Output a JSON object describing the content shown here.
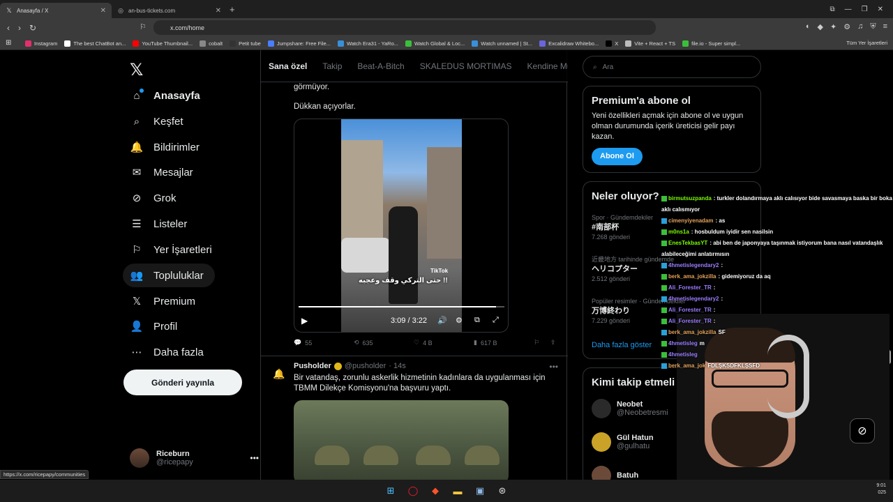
{
  "browser": {
    "tabs": [
      {
        "title": "Anasayfa / X",
        "icon": "x-logo-icon",
        "active": true
      },
      {
        "title": "an-bus-tickets.com",
        "icon": "globe-icon",
        "active": false
      }
    ],
    "url": "x.com/home",
    "bookmarks": [
      {
        "label": "Instagram",
        "color": "#e1306c"
      },
      {
        "label": "The best ChatBot an...",
        "color": "#ffffff"
      },
      {
        "label": "YouTube Thumbnail...",
        "color": "#ff0000"
      },
      {
        "label": "cobalt",
        "color": "#888888"
      },
      {
        "label": "Petit tube",
        "color": "#333333"
      },
      {
        "label": "Jumpshare: Free File...",
        "color": "#4a7dff"
      },
      {
        "label": "Watch Era31 - YaRo...",
        "color": "#3a8fd9"
      },
      {
        "label": "Watch Global & Loc...",
        "color": "#3bbf3b"
      },
      {
        "label": "Watch unnamed | St...",
        "color": "#3a8fd9"
      },
      {
        "label": "Excalidraw Whitebo...",
        "color": "#6965db"
      },
      {
        "label": "X",
        "color": "#000000"
      },
      {
        "label": "Vite + React + TS",
        "color": "#bbbbbb"
      },
      {
        "label": "file.io - Super simpl...",
        "color": "#3bbf3b"
      }
    ],
    "bookmarks_all": "Tüm Yer İşaretleri",
    "status_link": "https://x.com/ricepapy/communities"
  },
  "nav": {
    "items": [
      {
        "label": "Anasayfa",
        "icon": "home-icon"
      },
      {
        "label": "Keşfet",
        "icon": "search-icon"
      },
      {
        "label": "Bildirimler",
        "icon": "bell-icon"
      },
      {
        "label": "Mesajlar",
        "icon": "mail-icon"
      },
      {
        "label": "Grok",
        "icon": "grok-icon"
      },
      {
        "label": "Listeler",
        "icon": "list-icon"
      },
      {
        "label": "Yer İşaretleri",
        "icon": "bookmark-icon"
      },
      {
        "label": "Topluluklar",
        "icon": "communities-icon"
      },
      {
        "label": "Premium",
        "icon": "x-logo-icon"
      },
      {
        "label": "Profil",
        "icon": "profile-icon"
      },
      {
        "label": "Daha fazla",
        "icon": "more-circle-icon"
      }
    ],
    "post_button": "Gönderi yayınla",
    "user": {
      "name": "Riceburn",
      "handle": "@ricepapy"
    }
  },
  "feed": {
    "tabs": [
      "Sana özel",
      "Takip",
      "Beat-A-Bitch",
      "SKALEDUS MORTIMAS",
      "Kendine Müz"
    ],
    "tweet1": {
      "text_top": "görmüyor.",
      "text_second": "Dükkan açıyorlar.",
      "video": {
        "watermark": "TikTok",
        "caption": "حتى التركي وقف وعجبه !!",
        "time": "3:09 / 3:22",
        "progress": 0.96
      },
      "stats": {
        "replies": "55",
        "reposts": "635",
        "likes": "4 B",
        "views": "617 B"
      }
    },
    "tweet2": {
      "name": "Pusholder",
      "handle": "@pusholder",
      "time": "· 14s",
      "text": "Bir vatandaş, zorunlu askerlik hizmetinin kadınlara da uygulanması için TBMM Dilekçe Komisyonu'na başvuru yaptı."
    }
  },
  "right": {
    "search_placeholder": "Ara",
    "premium": {
      "title": "Premium'a abone ol",
      "body": "Yeni özellikleri açmak için abone ol ve uygun olman durumunda içerik üreticisi gelir payı kazan.",
      "button": "Abone Ol"
    },
    "trends_title": "Neler oluyor?",
    "trends": [
      {
        "meta": "Spor · Gündemdekiler",
        "topic": "#南部杯",
        "count": "7.268 gönderi"
      },
      {
        "meta": "近畿地方 tarihinde gündemde",
        "topic": "ヘリコプター",
        "count": "2.512 gönderi"
      },
      {
        "meta": "Popüler resimler · Gündemdekiler",
        "topic": "万博終わり",
        "count": "7.229 gönderi"
      }
    ],
    "show_more": "Daha fazla göster",
    "who_to_follow": "Kimi takip etmeli",
    "follows": [
      {
        "name": "Neobet",
        "handle": "@Neobetresmi",
        "color": "#2a2a2a"
      },
      {
        "name": "Gül Hatun",
        "handle": "@gulhatu",
        "color": "#c9a227"
      },
      {
        "name": "Batuh",
        "handle": "",
        "color": "#6b4a3a"
      }
    ]
  },
  "chat": [
    {
      "user": "birmutsuzpanda",
      "msg": ": turkler dolandırmaya aklı calısıyor bide savasmaya baska bir boka aklı calısmıyor",
      "color": "#7cfc00"
    },
    {
      "user": "cimenyiyenadam",
      "msg": ": as",
      "color": "#e4a25a"
    },
    {
      "user": "m0ns1a",
      "msg": ": hosbuldum iyidir sen nasilsin",
      "color": "#7cfc00"
    },
    {
      "user": "EnesTekbasYT",
      "msg": ": abi ben de japonyaya taşınmak istiyorum bana nasıl vatandaşlık alabileceğimi anlatırmısın",
      "color": "#7cfc00"
    },
    {
      "user": "4hmetislegendary2",
      "msg": ":",
      "color": "#9b7dff"
    },
    {
      "user": "berk_ama_jokzilla",
      "msg": ": gidemiyoruz da aq",
      "color": "#e4a25a"
    },
    {
      "user": "Ali_Forester_TR",
      "msg": ":",
      "color": "#9b7dff"
    },
    {
      "user": "4hmetislegendary2",
      "msg": ":",
      "color": "#9b7dff"
    },
    {
      "user": "Ali_Forester_TR",
      "msg": ":",
      "color": "#9b7dff"
    },
    {
      "user": "Ali_Forester_TR",
      "msg": ":",
      "color": "#9b7dff"
    },
    {
      "user": "berk_ama_jokzilla",
      "msg": "SF",
      "color": "#e4a25a"
    },
    {
      "user": "4hmetisleg",
      "msg": "m",
      "color": "#9b7dff"
    },
    {
      "user": "4hmetisleg",
      "msg": "",
      "color": "#9b7dff"
    },
    {
      "user": "berk_ama_jok",
      "msg": "FDLŞKSDFKLŞSFD",
      "color": "#e4a25a"
    }
  ],
  "tray": {
    "time": "9:01",
    "date": "025"
  }
}
